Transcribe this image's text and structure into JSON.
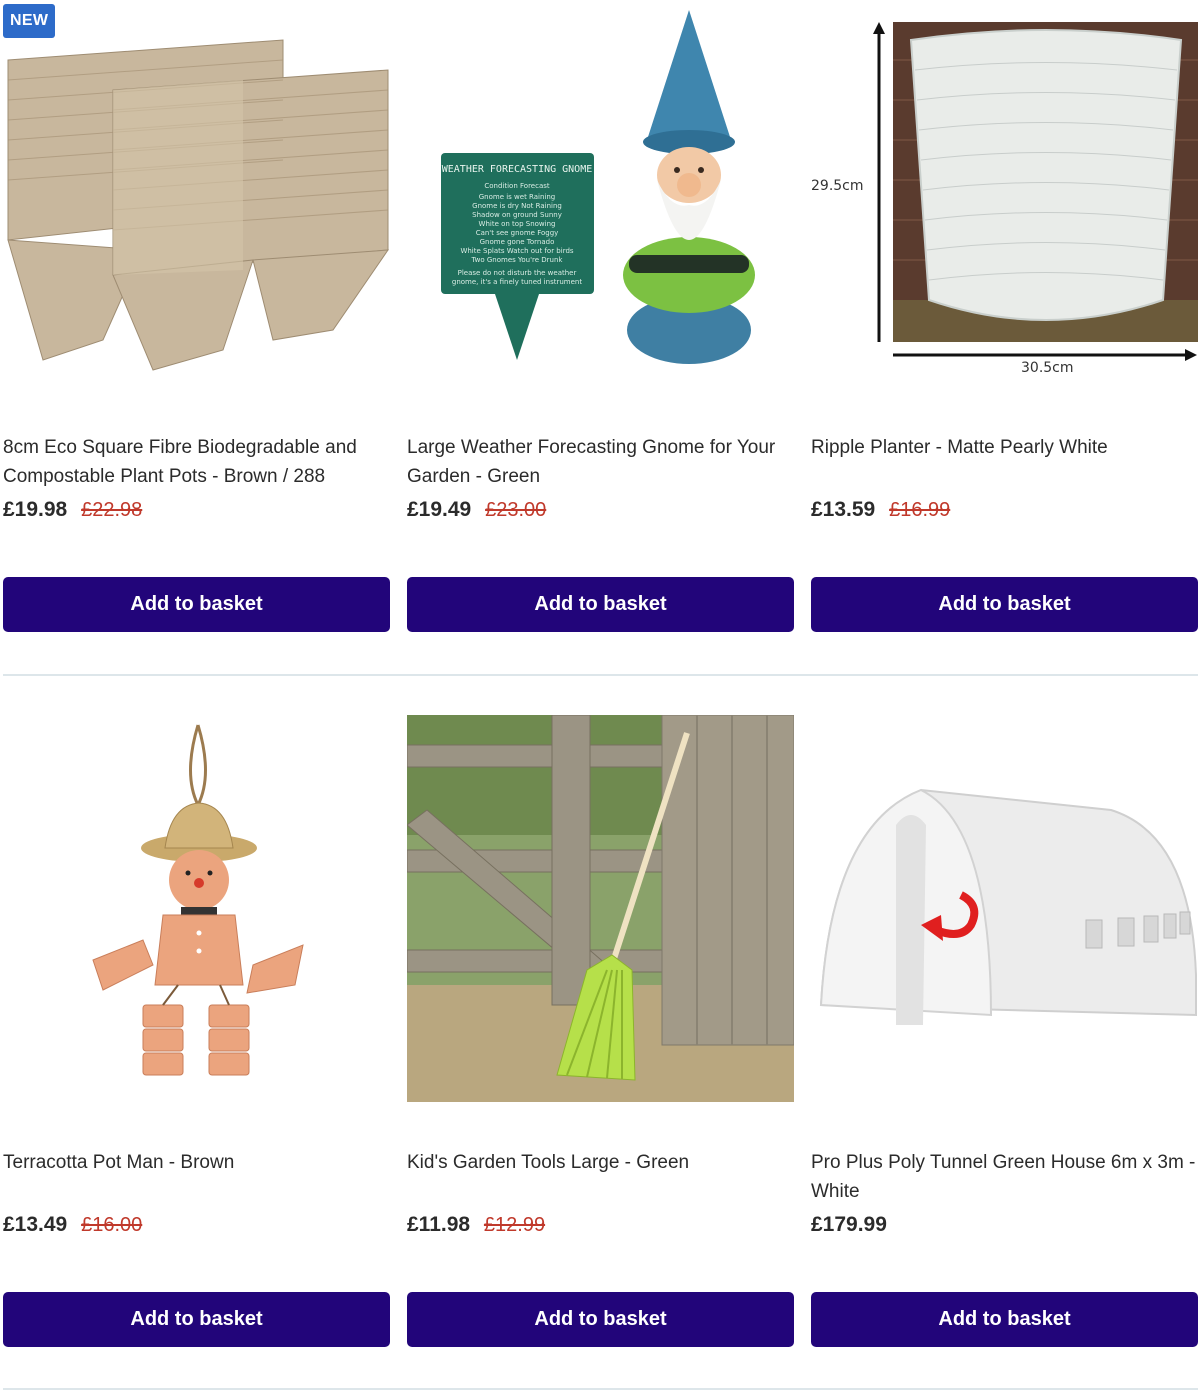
{
  "products": [
    {
      "badge": "NEW",
      "title": "8cm Eco Square Fibre Biodegradable and Compostable Plant Pots - Brown / 288",
      "price": "£19.98",
      "was_price": "£22.98",
      "button": "Add to basket"
    },
    {
      "title": "Large Weather Forecasting Gnome for Your Garden - Green",
      "price": "£19.49",
      "was_price": "£23.00",
      "button": "Add to basket",
      "sign_lines": [
        "WEATHER FORECASTING GNOME",
        "Condition   Forecast",
        "Gnome is wet   Raining",
        "Gnome is dry   Not Raining",
        "Shadow on ground   Sunny",
        "White on top   Snowing",
        "Can't see gnome   Foggy",
        "Gnome gone   Tornado",
        "White Splats   Watch out for birds",
        "Two Gnomes   You're Drunk",
        "Please do not disturb the weather",
        "gnome, it's a finely tuned instrument"
      ]
    },
    {
      "title": "Ripple Planter - Matte Pearly White",
      "price": "£13.59",
      "was_price": "£16.99",
      "button": "Add to basket",
      "height_label": "29.5cm",
      "width_label": "30.5cm"
    },
    {
      "title": "Terracotta Pot Man - Brown",
      "price": "£13.49",
      "was_price": "£16.00",
      "button": "Add to basket"
    },
    {
      "title": "Kid's Garden Tools Large - Green",
      "price": "£11.98",
      "was_price": "£12.99",
      "button": "Add to basket"
    },
    {
      "title": "Pro Plus Poly Tunnel Green House 6m x 3m - White",
      "price": "£179.99",
      "was_price": "",
      "button": "Add to basket"
    }
  ],
  "colors": {
    "button_bg": "#22057a",
    "was_price": "#c0392b",
    "badge_bg": "#2d6bc9"
  }
}
